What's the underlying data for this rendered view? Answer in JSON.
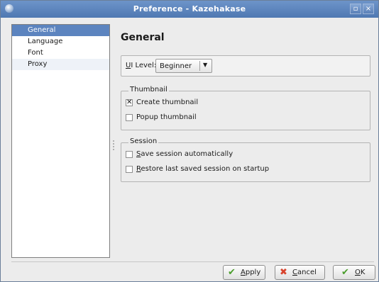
{
  "window": {
    "title": "Preference - Kazehakase",
    "maximize_glyph": "▫",
    "close_glyph": "×"
  },
  "sidebar": {
    "items": [
      {
        "label": "General"
      },
      {
        "label": "Language"
      },
      {
        "label": "Font"
      },
      {
        "label": "Proxy"
      }
    ]
  },
  "page": {
    "title": "General"
  },
  "ui_level": {
    "label_mn": "U",
    "label_rest": "I Level:",
    "value": "Beginner",
    "arrow": "▼"
  },
  "thumbnail": {
    "legend": "Thumbnail",
    "create": {
      "mn": "",
      "rest": "Create thumbnail",
      "mark": "✕"
    },
    "popup": {
      "mn": "",
      "rest": "Popup thumbnail",
      "mark": ""
    }
  },
  "session": {
    "legend": "Session",
    "save": {
      "mn": "S",
      "rest": "ave session automatically",
      "mark": ""
    },
    "restore": {
      "mn": "R",
      "rest": "estore last saved session on startup",
      "mark": ""
    }
  },
  "buttons": {
    "apply": {
      "icon": "✔",
      "mn": "A",
      "rest": "pply"
    },
    "cancel": {
      "icon": "✖",
      "mn": "C",
      "rest": "ancel"
    },
    "ok": {
      "icon": "✔",
      "mn": "O",
      "rest": "K"
    }
  },
  "colors": {
    "selection": "#5c84bf",
    "titlebar": "#5a82bc",
    "apply_icon": "#4a9d2c",
    "cancel_icon": "#d8432d",
    "ok_icon": "#4a9d2c"
  }
}
